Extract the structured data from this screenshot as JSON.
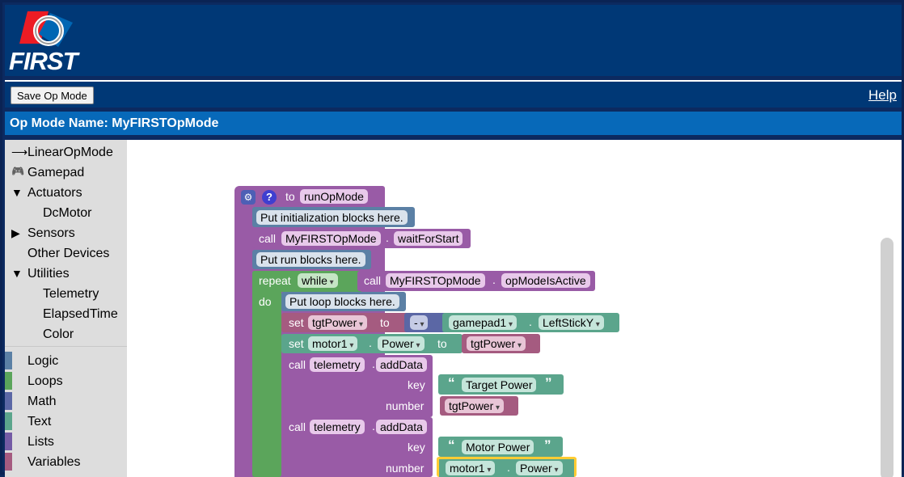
{
  "header": {
    "logo_text": "FIRST"
  },
  "toolbar": {
    "save_label": "Save Op Mode",
    "help_label": "Help"
  },
  "opmode": {
    "title": "Op Mode Name: MyFIRSTOpMode"
  },
  "toolbox": {
    "items": [
      {
        "label": "LinearOpMode",
        "arrow": "⟶",
        "icon": "arrow-right-icon"
      },
      {
        "label": "Gamepad",
        "arrow": "🎮",
        "icon": "gamepad-icon"
      },
      {
        "label": "Actuators",
        "arrow": "▼",
        "icon": "expanded-triangle-icon"
      },
      {
        "label": "DcMotor",
        "arrow": "",
        "icon": ""
      },
      {
        "label": "Sensors",
        "arrow": "▶",
        "icon": "collapsed-triangle-icon"
      },
      {
        "label": "Other Devices",
        "arrow": "",
        "icon": ""
      },
      {
        "label": "Utilities",
        "arrow": "▼",
        "icon": "expanded-triangle-icon"
      },
      {
        "label": "Telemetry",
        "arrow": "",
        "icon": ""
      },
      {
        "label": "ElapsedTime",
        "arrow": "",
        "icon": ""
      },
      {
        "label": "Color",
        "arrow": "",
        "icon": ""
      }
    ],
    "categories": [
      {
        "label": "Logic",
        "color": "#5b80a5"
      },
      {
        "label": "Loops",
        "color": "#5ba55b"
      },
      {
        "label": "Math",
        "color": "#5b67a5"
      },
      {
        "label": "Text",
        "color": "#5ba58c"
      },
      {
        "label": "Lists",
        "color": "#745ba5"
      },
      {
        "label": "Variables",
        "color": "#a55b80"
      }
    ]
  },
  "blocks": {
    "to": "to",
    "run_opmode": "runOpMode",
    "init_comment": "Put initialization blocks here.",
    "call": "call",
    "myfirst": "MyFIRSTOpMode",
    "dot": ".",
    "wait_for_start": "waitForStart",
    "run_comment": "Put run blocks here.",
    "repeat": "repeat",
    "while": "while",
    "op_mode_is_active": "opModeIsActive",
    "do": "do",
    "loop_comment": "Put loop blocks here.",
    "set": "set",
    "tgt_power": "tgtPower",
    "to2": "to",
    "minus": "-",
    "gamepad1": "gamepad1",
    "left_stick_y": "LeftStickY",
    "motor1": "motor1",
    "power": "Power",
    "telemetry": "telemetry",
    "add_data": "addData",
    "key": "key",
    "number": "number",
    "target_power": "Target Power",
    "motor_power": "Motor Power",
    "quote_open": "“",
    "quote_close": "”"
  },
  "colors": {
    "header": "#003876",
    "title_bar": "#0769b9",
    "procedure": "#995ba6",
    "comment": "#5b80a5",
    "loop": "#5ba55b",
    "variable": "#a55b80",
    "math": "#5b67a5",
    "text": "#5ba58c"
  }
}
